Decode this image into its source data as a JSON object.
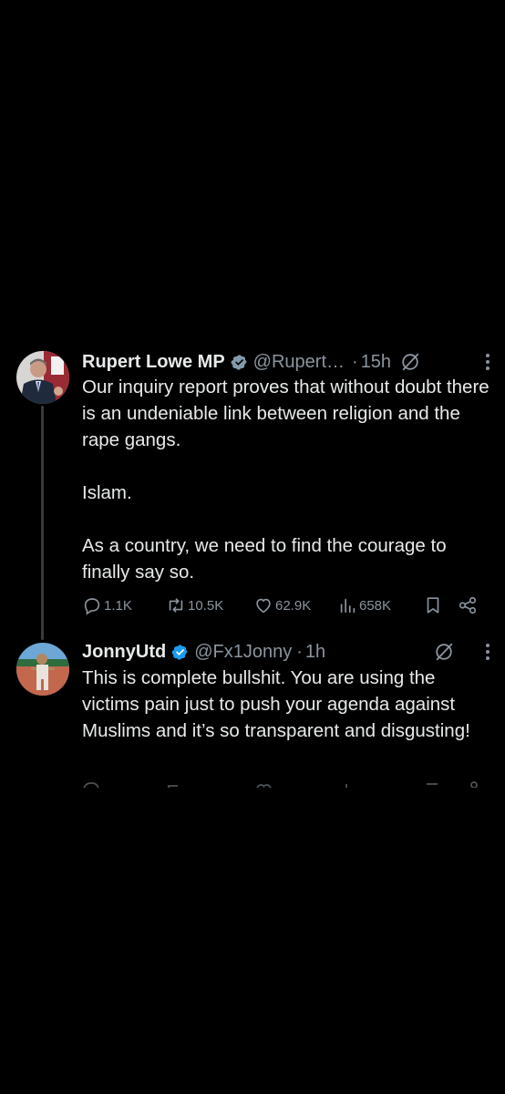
{
  "colors": {
    "background": "#000000",
    "text_primary": "#e7e9ea",
    "text_secondary": "#8b949e",
    "verified_blue": "#1d9bf0",
    "verified_gray": "#829aab",
    "thread_line": "#3a3a3a"
  },
  "tweets": [
    {
      "author": "Rupert Lowe MP",
      "handle": "@Rupert…",
      "dot": "·",
      "time": "15h",
      "badge": "verified-gray-icon",
      "text": "Our inquiry report proves that without doubt there is an undeniable link between religion and the rape gangs.\n\nIslam.\n\nAs a country, we need to find the courage to finally say so.",
      "stats": {
        "replies": "1.1K",
        "reposts": "10.5K",
        "likes": "62.9K",
        "views": "658K"
      }
    },
    {
      "author": "JonnyUtd",
      "handle": "@Fx1Jonny",
      "dot": "·",
      "time": "1h",
      "badge": "verified-blue-icon",
      "text": "This is complete bullshit. You are using the victims pain just to push your agenda against Muslims and it’s so transparent and disgusting!"
    }
  ]
}
